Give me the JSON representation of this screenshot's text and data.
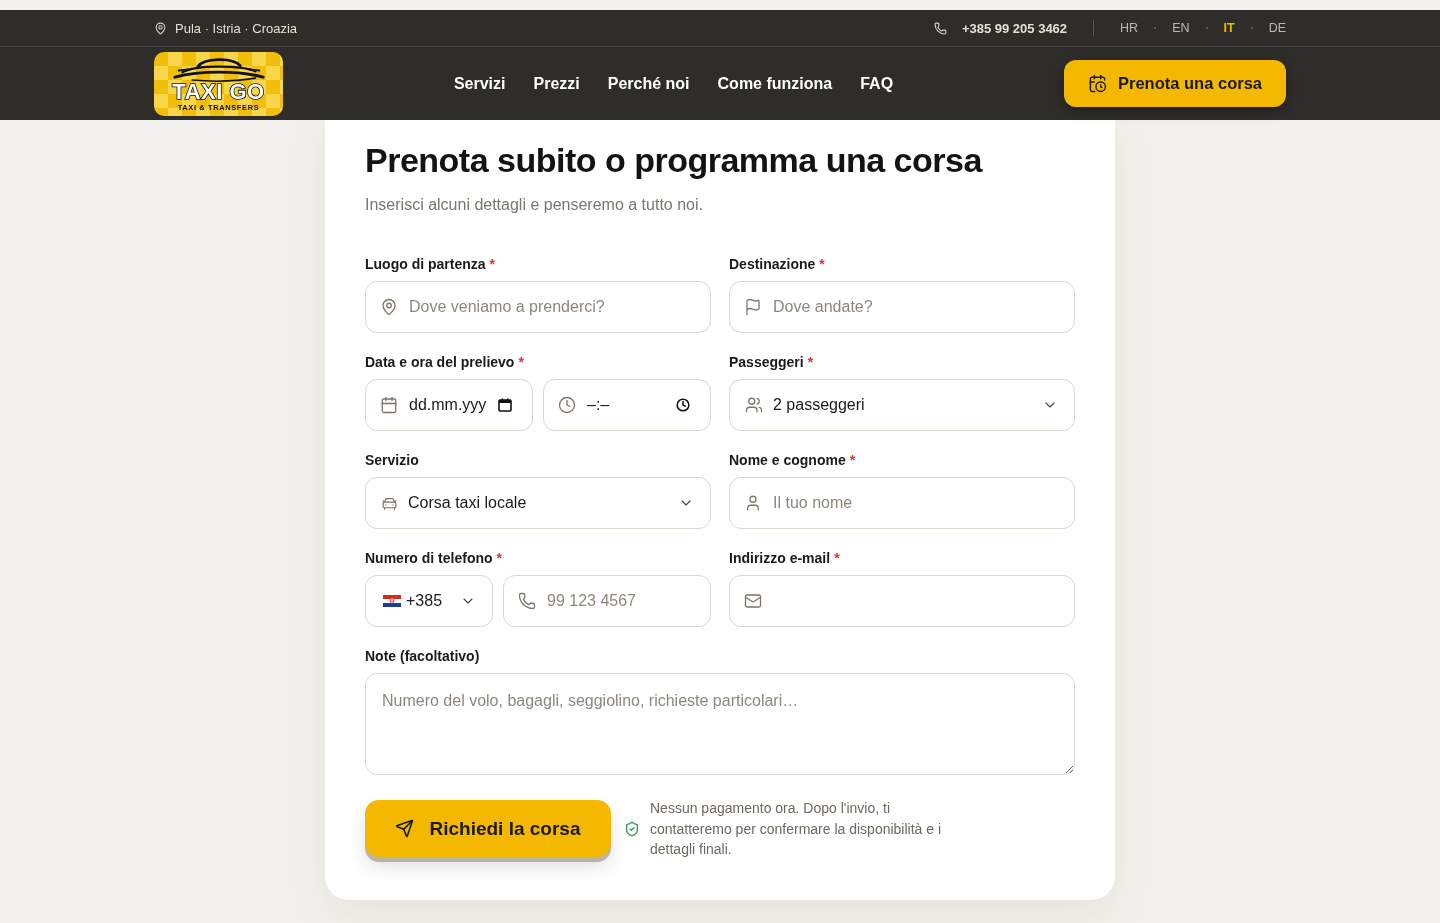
{
  "top_bar": {
    "location": "Pula · Istria · Croazia",
    "phone": "+385 99 205 3462",
    "languages": [
      {
        "label": "HR",
        "selected": false
      },
      {
        "label": "EN",
        "selected": false
      },
      {
        "label": "IT",
        "selected": true
      },
      {
        "label": "DE",
        "selected": false
      }
    ]
  },
  "nav": {
    "logo": {
      "title": "TAXI GO",
      "tagline": "TAXI & TRANSFERS"
    },
    "links": [
      "Servizi",
      "Prezzi",
      "Perché noi",
      "Come funziona",
      "FAQ"
    ],
    "cta": "Prenota una corsa"
  },
  "form": {
    "title": "Prenota subito o programma una corsa",
    "subtitle": "Inserisci alcuni dettagli e penseremo a tutto noi.",
    "pickup": {
      "label": "Luogo di partenza",
      "required_mark": "*",
      "placeholder": "Dove veniamo a prenderci?"
    },
    "destination": {
      "label": "Destinazione",
      "required_mark": "*",
      "placeholder": "Dove andate?"
    },
    "pickup_time": {
      "label": "Data e ora del prelievo",
      "required_mark": "*",
      "date": {
        "placeholder": "dd.mm.yyy"
      },
      "time": {
        "placeholder": "–:–"
      }
    },
    "passengers": {
      "label": "Passeggeri",
      "required_mark": "*",
      "value": "2 passeggeri"
    },
    "service": {
      "label": "Servizio",
      "value": "Corsa taxi locale"
    },
    "name": {
      "label": "Nome e cognome",
      "required_mark": "*",
      "placeholder": "Il tuo nome"
    },
    "phone": {
      "label": "Numero di telefono",
      "required_mark": "*",
      "country_code": "+385",
      "placeholder": "99 123 4567"
    },
    "email": {
      "label": "Indirizzo e-mail",
      "required_mark": "*"
    },
    "notes": {
      "label": "Note (facoltativo)",
      "placeholder": "Numero del volo, bagagli, seggiolino, richieste particolari…"
    },
    "submit": "Richiedi la corsa",
    "disclaimer": "Nessun pagamento ora. Dopo l'invio, ti contatteremo per confermare la disponibilità e i dettagli finali."
  }
}
